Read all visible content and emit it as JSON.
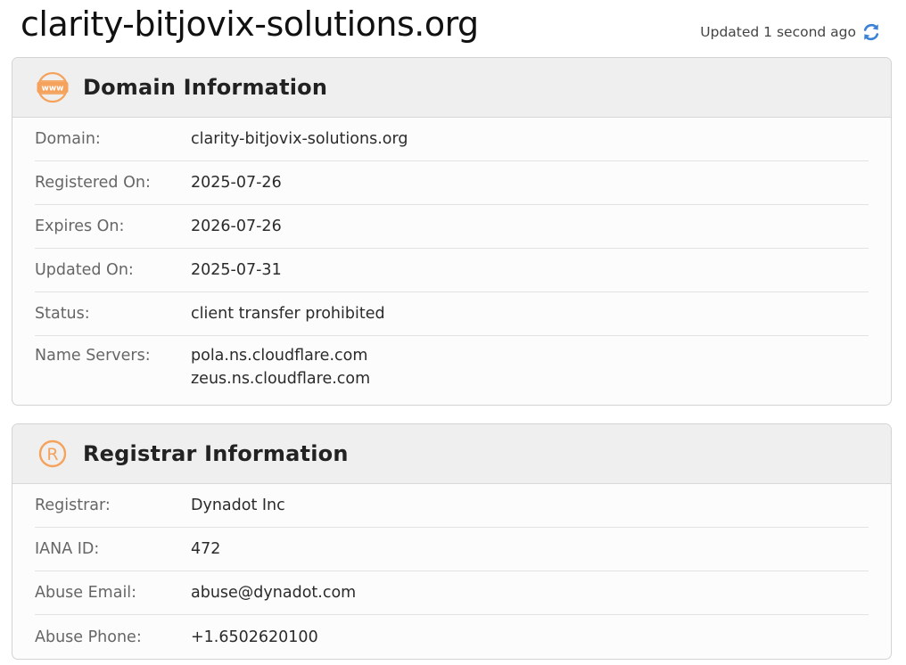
{
  "header": {
    "domain_title": "clarity-bitjovix-solutions.org",
    "updated_text": "Updated 1 second ago",
    "refresh_icon": "refresh-icon"
  },
  "colors": {
    "accent_orange": "#f5a25d",
    "refresh_blue": "#3b82d6"
  },
  "domain_info": {
    "title": "Domain Information",
    "icon": "www-icon",
    "rows": [
      {
        "label": "Domain:",
        "value": "clarity-bitjovix-solutions.org"
      },
      {
        "label": "Registered On:",
        "value": "2025-07-26"
      },
      {
        "label": "Expires On:",
        "value": "2026-07-26"
      },
      {
        "label": "Updated On:",
        "value": "2025-07-31"
      },
      {
        "label": "Status:",
        "value": "client transfer prohibited"
      }
    ],
    "name_servers": {
      "label": "Name Servers:",
      "values": [
        "pola.ns.cloudflare.com",
        "zeus.ns.cloudflare.com"
      ]
    }
  },
  "registrar_info": {
    "title": "Registrar Information",
    "icon": "registered-icon",
    "rows": [
      {
        "label": "Registrar:",
        "value": "Dynadot Inc"
      },
      {
        "label": "IANA ID:",
        "value": "472"
      },
      {
        "label": "Abuse Email:",
        "value": "abuse@dynadot.com"
      },
      {
        "label": "Abuse Phone:",
        "value": "+1.6502620100"
      }
    ]
  }
}
